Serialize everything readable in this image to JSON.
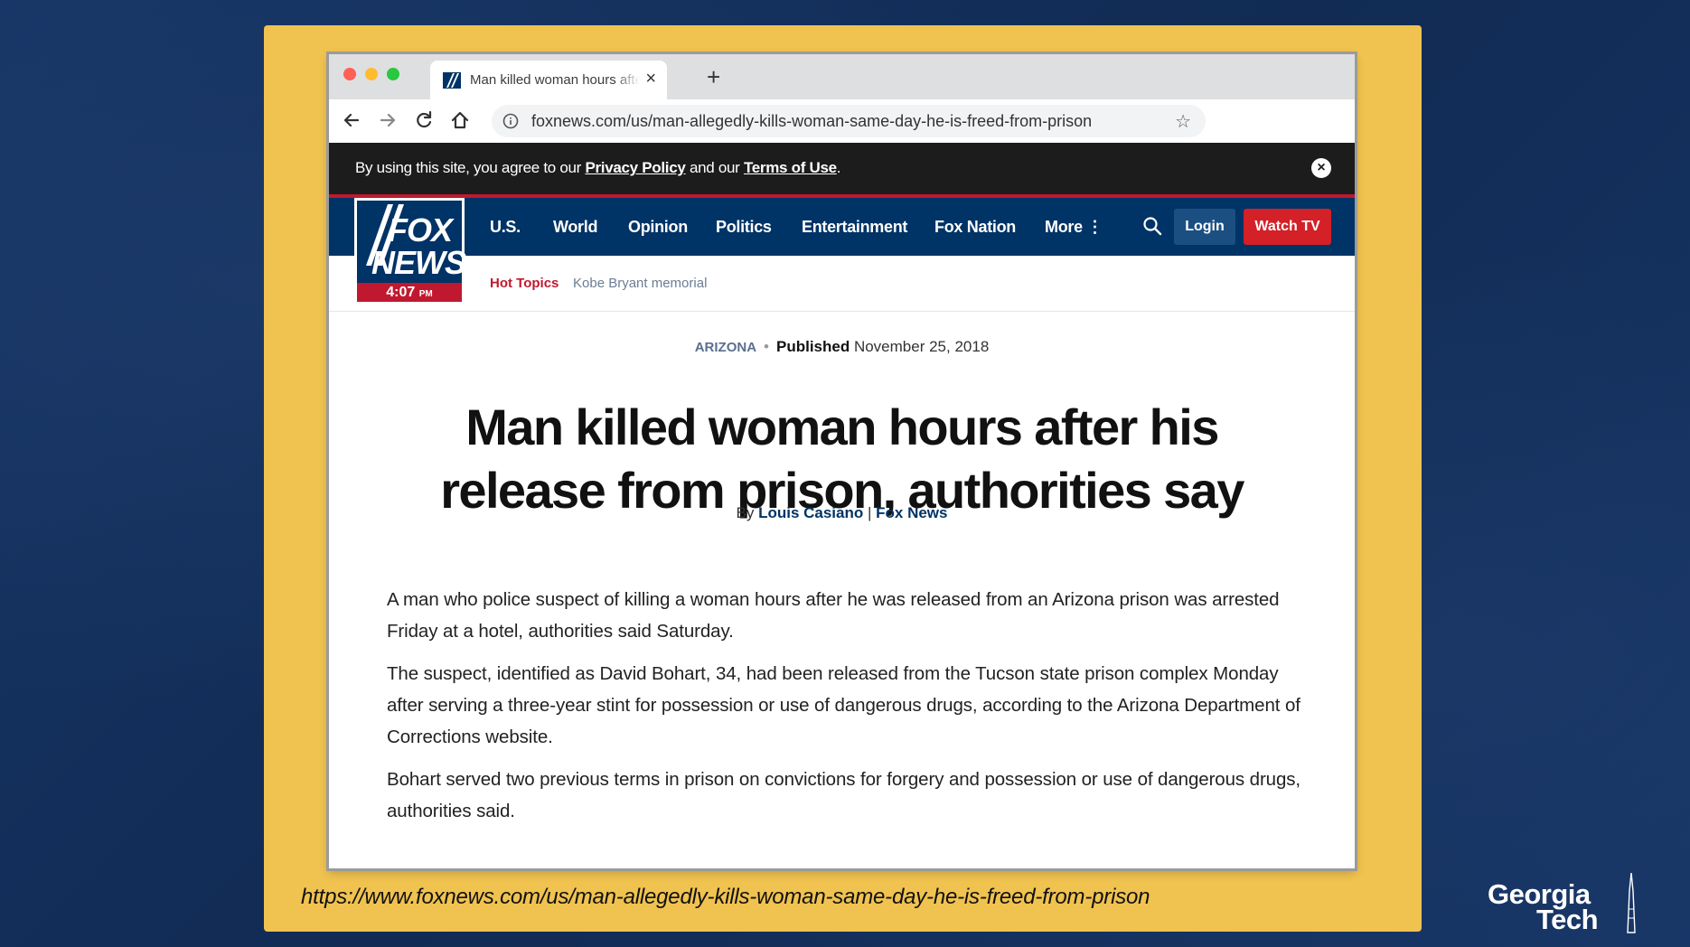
{
  "browser": {
    "tab_title": "Man killed woman hours after his",
    "tab_close": "×",
    "new_tab": "+",
    "url": "foxnews.com/us/man-allegedly-kills-woman-same-day-he-is-freed-from-prison"
  },
  "cookie_banner": {
    "prefix": "By using this site, you agree to our ",
    "privacy_link": "Privacy Policy",
    "middle": " and our ",
    "terms_link": "Terms of Use",
    "suffix": ".",
    "close": "×"
  },
  "logo": {
    "line1": "FOX",
    "line2": "NEWS",
    "time": "4:07",
    "ampm": "PM"
  },
  "nav": {
    "items": [
      "U.S.",
      "World",
      "Opinion",
      "Politics",
      "Entertainment",
      "Fox Nation",
      "More ⋮"
    ],
    "login": "Login",
    "watch_tv": "Watch TV"
  },
  "hot_topics": {
    "label": "Hot Topics",
    "link": "Kobe Bryant memorial"
  },
  "article": {
    "category": "ARIZONA",
    "separator": "•",
    "published_label": "Published",
    "published_date": "November 25, 2018",
    "headline": "Man killed woman hours after his release from prison, authorities say",
    "byline_prefix": "By ",
    "author": "Louis Casiano",
    "byline_sep": " | ",
    "outlet": "Fox News",
    "paragraphs": [
      "A man who police suspect of killing a woman hours after he was released from an Arizona prison was arrested Friday at a hotel, authorities said Saturday.",
      "The suspect, identified as David Bohart, 34, had been released from the Tucson state prison complex Monday after serving a three-year stint for possession or use of dangerous drugs, according to the Arizona Department of Corrections website.",
      "Bohart served two previous terms in prison on convictions for forgery and possession or use of dangerous drugs, authorities said."
    ]
  },
  "slide": {
    "caption": "https://www.foxnews.com/us/man-allegedly-kills-woman-same-day-he-is-freed-from-prison",
    "gt_line1": "Georgia",
    "gt_line2": "Tech"
  },
  "colors": {
    "slide_background": "#13305c",
    "card": "#f0c24f",
    "fox_navy": "#003366",
    "fox_red": "#c0192f"
  }
}
